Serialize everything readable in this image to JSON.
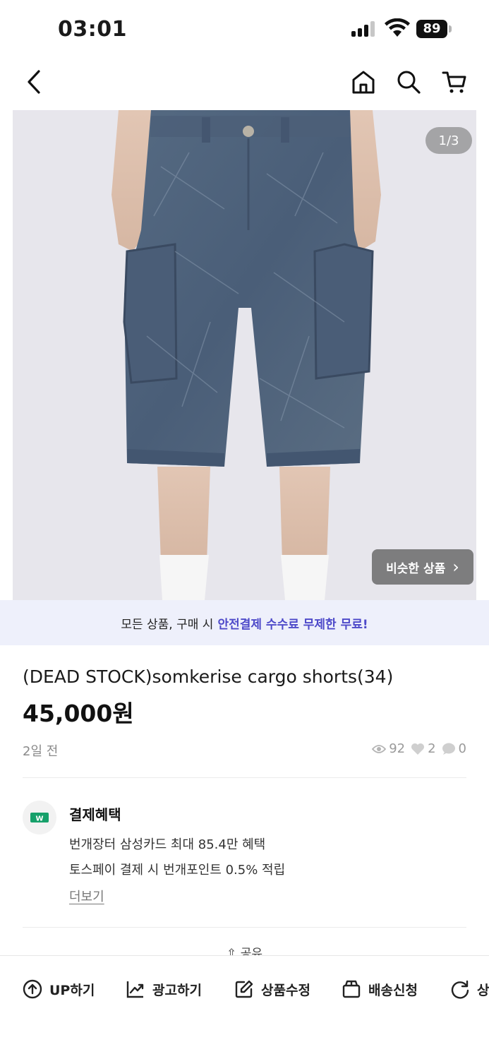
{
  "status_bar": {
    "time": "03:01",
    "battery": "89"
  },
  "product_image": {
    "counter": "1/3",
    "similar_label": "비슷한 상품",
    "similar_chevron": "›"
  },
  "banner": {
    "prefix": "모든 상품, 구매 시",
    "accent": "안전결제 수수료 무제한 무료!"
  },
  "product": {
    "title": "(DEAD STOCK)somkerise cargo shorts(34)",
    "price": "45,000원",
    "posted": "2일 전",
    "views": "92",
    "likes": "2",
    "comments": "0"
  },
  "benefits": {
    "heading": "결제혜택",
    "line1": "번개장터 삼성카드 최대 85.4만 혜택",
    "line2": "토스페이 결제 시 번개포인트 0.5% 적립",
    "more": "더보기",
    "icon_glyph": "W"
  },
  "share_label": "공유",
  "toolbar": {
    "up": "UP하기",
    "ad": "광고하기",
    "edit": "상품수정",
    "delivery": "배송신청",
    "last": "상"
  },
  "colors": {
    "accent": "#4d49c9",
    "banner_bg": "#eef0fb",
    "benefit_icon": "#16a06a"
  }
}
